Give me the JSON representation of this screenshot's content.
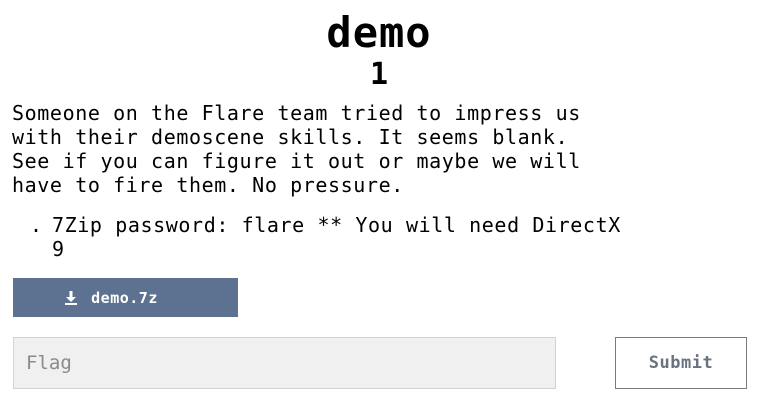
{
  "challenge": {
    "title": "demo",
    "points": "1",
    "description": "Someone on the Flare team tried to impress us\nwith their demoscene skills. It seems blank.\nSee if you can figure it out or maybe we will\nhave to fire them. No pressure.",
    "notes": [
      {
        "bullet": ".",
        "text": "7Zip password: flare ** You will need DirectX 9"
      }
    ]
  },
  "download": {
    "label": "demo.7z",
    "icon": "download-icon",
    "color": "#5d7190"
  },
  "flag_form": {
    "placeholder": "Flag",
    "value": "",
    "submit_label": "Submit"
  }
}
